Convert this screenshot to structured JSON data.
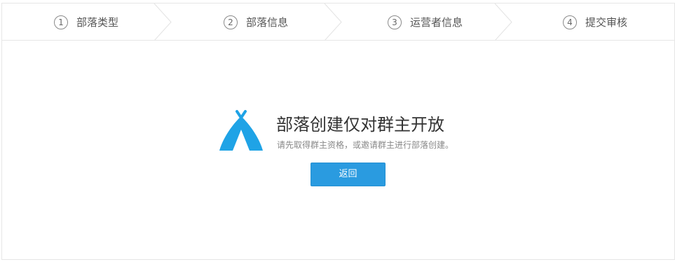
{
  "steps": [
    {
      "num": "1",
      "label": "部落类型"
    },
    {
      "num": "2",
      "label": "部落信息"
    },
    {
      "num": "3",
      "label": "运营者信息"
    },
    {
      "num": "4",
      "label": "提交审核"
    }
  ],
  "notice": {
    "heading": "部落创建仅对群主开放",
    "subtext": "请先取得群主资格，或邀请群主进行部落创建。",
    "back_label": "返回"
  },
  "colors": {
    "accent": "#2a9be0",
    "tent": "#1fa3e6"
  }
}
